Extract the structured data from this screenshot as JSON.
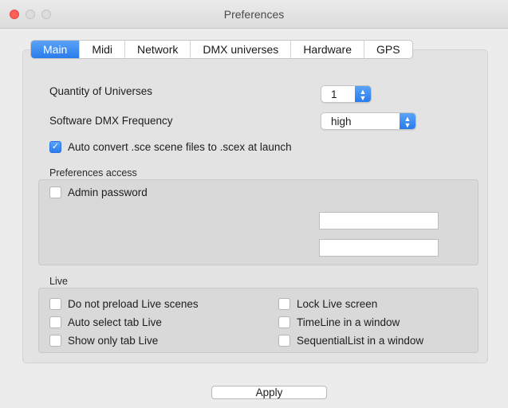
{
  "window": {
    "title": "Preferences"
  },
  "tabs": [
    {
      "label": "Main",
      "active": true
    },
    {
      "label": "Midi",
      "active": false
    },
    {
      "label": "Network",
      "active": false
    },
    {
      "label": "DMX universes",
      "active": false
    },
    {
      "label": "Hardware",
      "active": false
    },
    {
      "label": "GPS",
      "active": false
    }
  ],
  "main": {
    "quantity_label": "Quantity of Universes",
    "quantity_value": "1",
    "frequency_label": "Software DMX Frequency",
    "frequency_value": "high",
    "auto_convert_label": "Auto convert .sce scene files to .scex at launch",
    "auto_convert_checked": true
  },
  "preferences_access": {
    "title": "Preferences access",
    "admin_password_label": "Admin password",
    "admin_password_checked": false,
    "field1_value": "",
    "field2_value": ""
  },
  "live": {
    "title": "Live",
    "options": [
      {
        "label": "Do not preload Live scenes",
        "checked": false
      },
      {
        "label": "Auto select tab Live",
        "checked": false
      },
      {
        "label": "Show only tab Live",
        "checked": false
      },
      {
        "label": "Lock Live screen",
        "checked": false
      },
      {
        "label": "TimeLine in a window",
        "checked": false
      },
      {
        "label": "SequentialList in a window",
        "checked": false
      }
    ]
  },
  "footer": {
    "apply_label": "Apply"
  },
  "colors": {
    "accent": "#2a7bec",
    "close_button": "#fc5f57"
  },
  "icons": {
    "stepper": "updown-chevron-icon",
    "checkmark": "checkmark-icon"
  }
}
